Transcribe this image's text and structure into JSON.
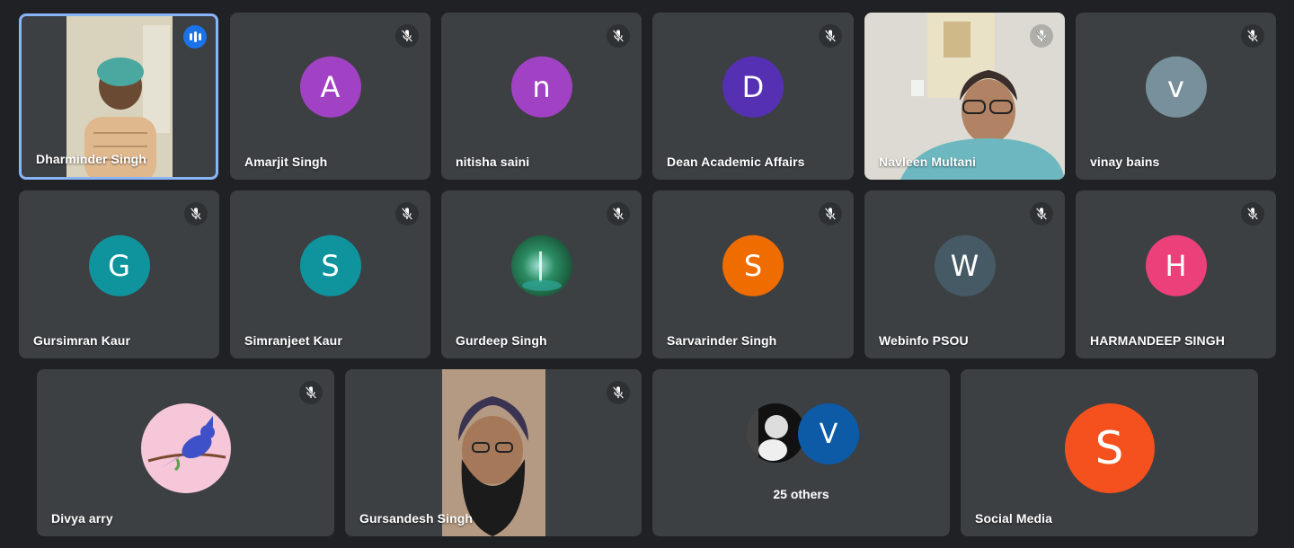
{
  "colors": {
    "background": "#202124",
    "tile": "#3c4043",
    "active_border": "#8ab4f8",
    "speaking": "#1a73e8"
  },
  "participants": [
    {
      "name": "Dharminder Singh",
      "type": "video",
      "speaking": true
    },
    {
      "name": "Amarjit Singh",
      "initial": "A",
      "color": "#a142c4",
      "muted": true
    },
    {
      "name": "nitisha saini",
      "initial": "n",
      "color": "#a142c4",
      "muted": true
    },
    {
      "name": "Dean Academic Affairs",
      "initial": "D",
      "color": "#5530b3",
      "muted": true
    },
    {
      "name": "Navleen Multani",
      "type": "video",
      "muted": true
    },
    {
      "name": "vinay bains",
      "initial": "v",
      "color": "#78909c",
      "muted": true
    },
    {
      "name": "Gursimran Kaur",
      "initial": "G",
      "color": "#0f949e",
      "muted": true
    },
    {
      "name": "Simranjeet Kaur",
      "initial": "S",
      "color": "#0f949e",
      "muted": true
    },
    {
      "name": "Gurdeep Singh",
      "type": "photo-avatar",
      "muted": true
    },
    {
      "name": "Sarvarinder Singh",
      "initial": "S",
      "color": "#ef6c00",
      "muted": true
    },
    {
      "name": "Webinfo PSOU",
      "initial": "W",
      "color": "#455a64",
      "muted": true
    },
    {
      "name": "HARMANDEEP SINGH",
      "initial": "H",
      "color": "#ec407a",
      "muted": true
    },
    {
      "name": "Divya arry",
      "type": "photo-avatar",
      "muted": true
    },
    {
      "name": "Gursandesh Singh",
      "type": "video",
      "muted": true
    },
    {
      "name": "Social Media",
      "initial": "S",
      "color": "#f4511e"
    }
  ],
  "others": {
    "label": "25 others",
    "avatar_initial": "V",
    "avatar_color": "#0d5aa7"
  },
  "icons": {
    "mic_off": "mic-off-icon",
    "speaking": "audio-level-icon"
  }
}
